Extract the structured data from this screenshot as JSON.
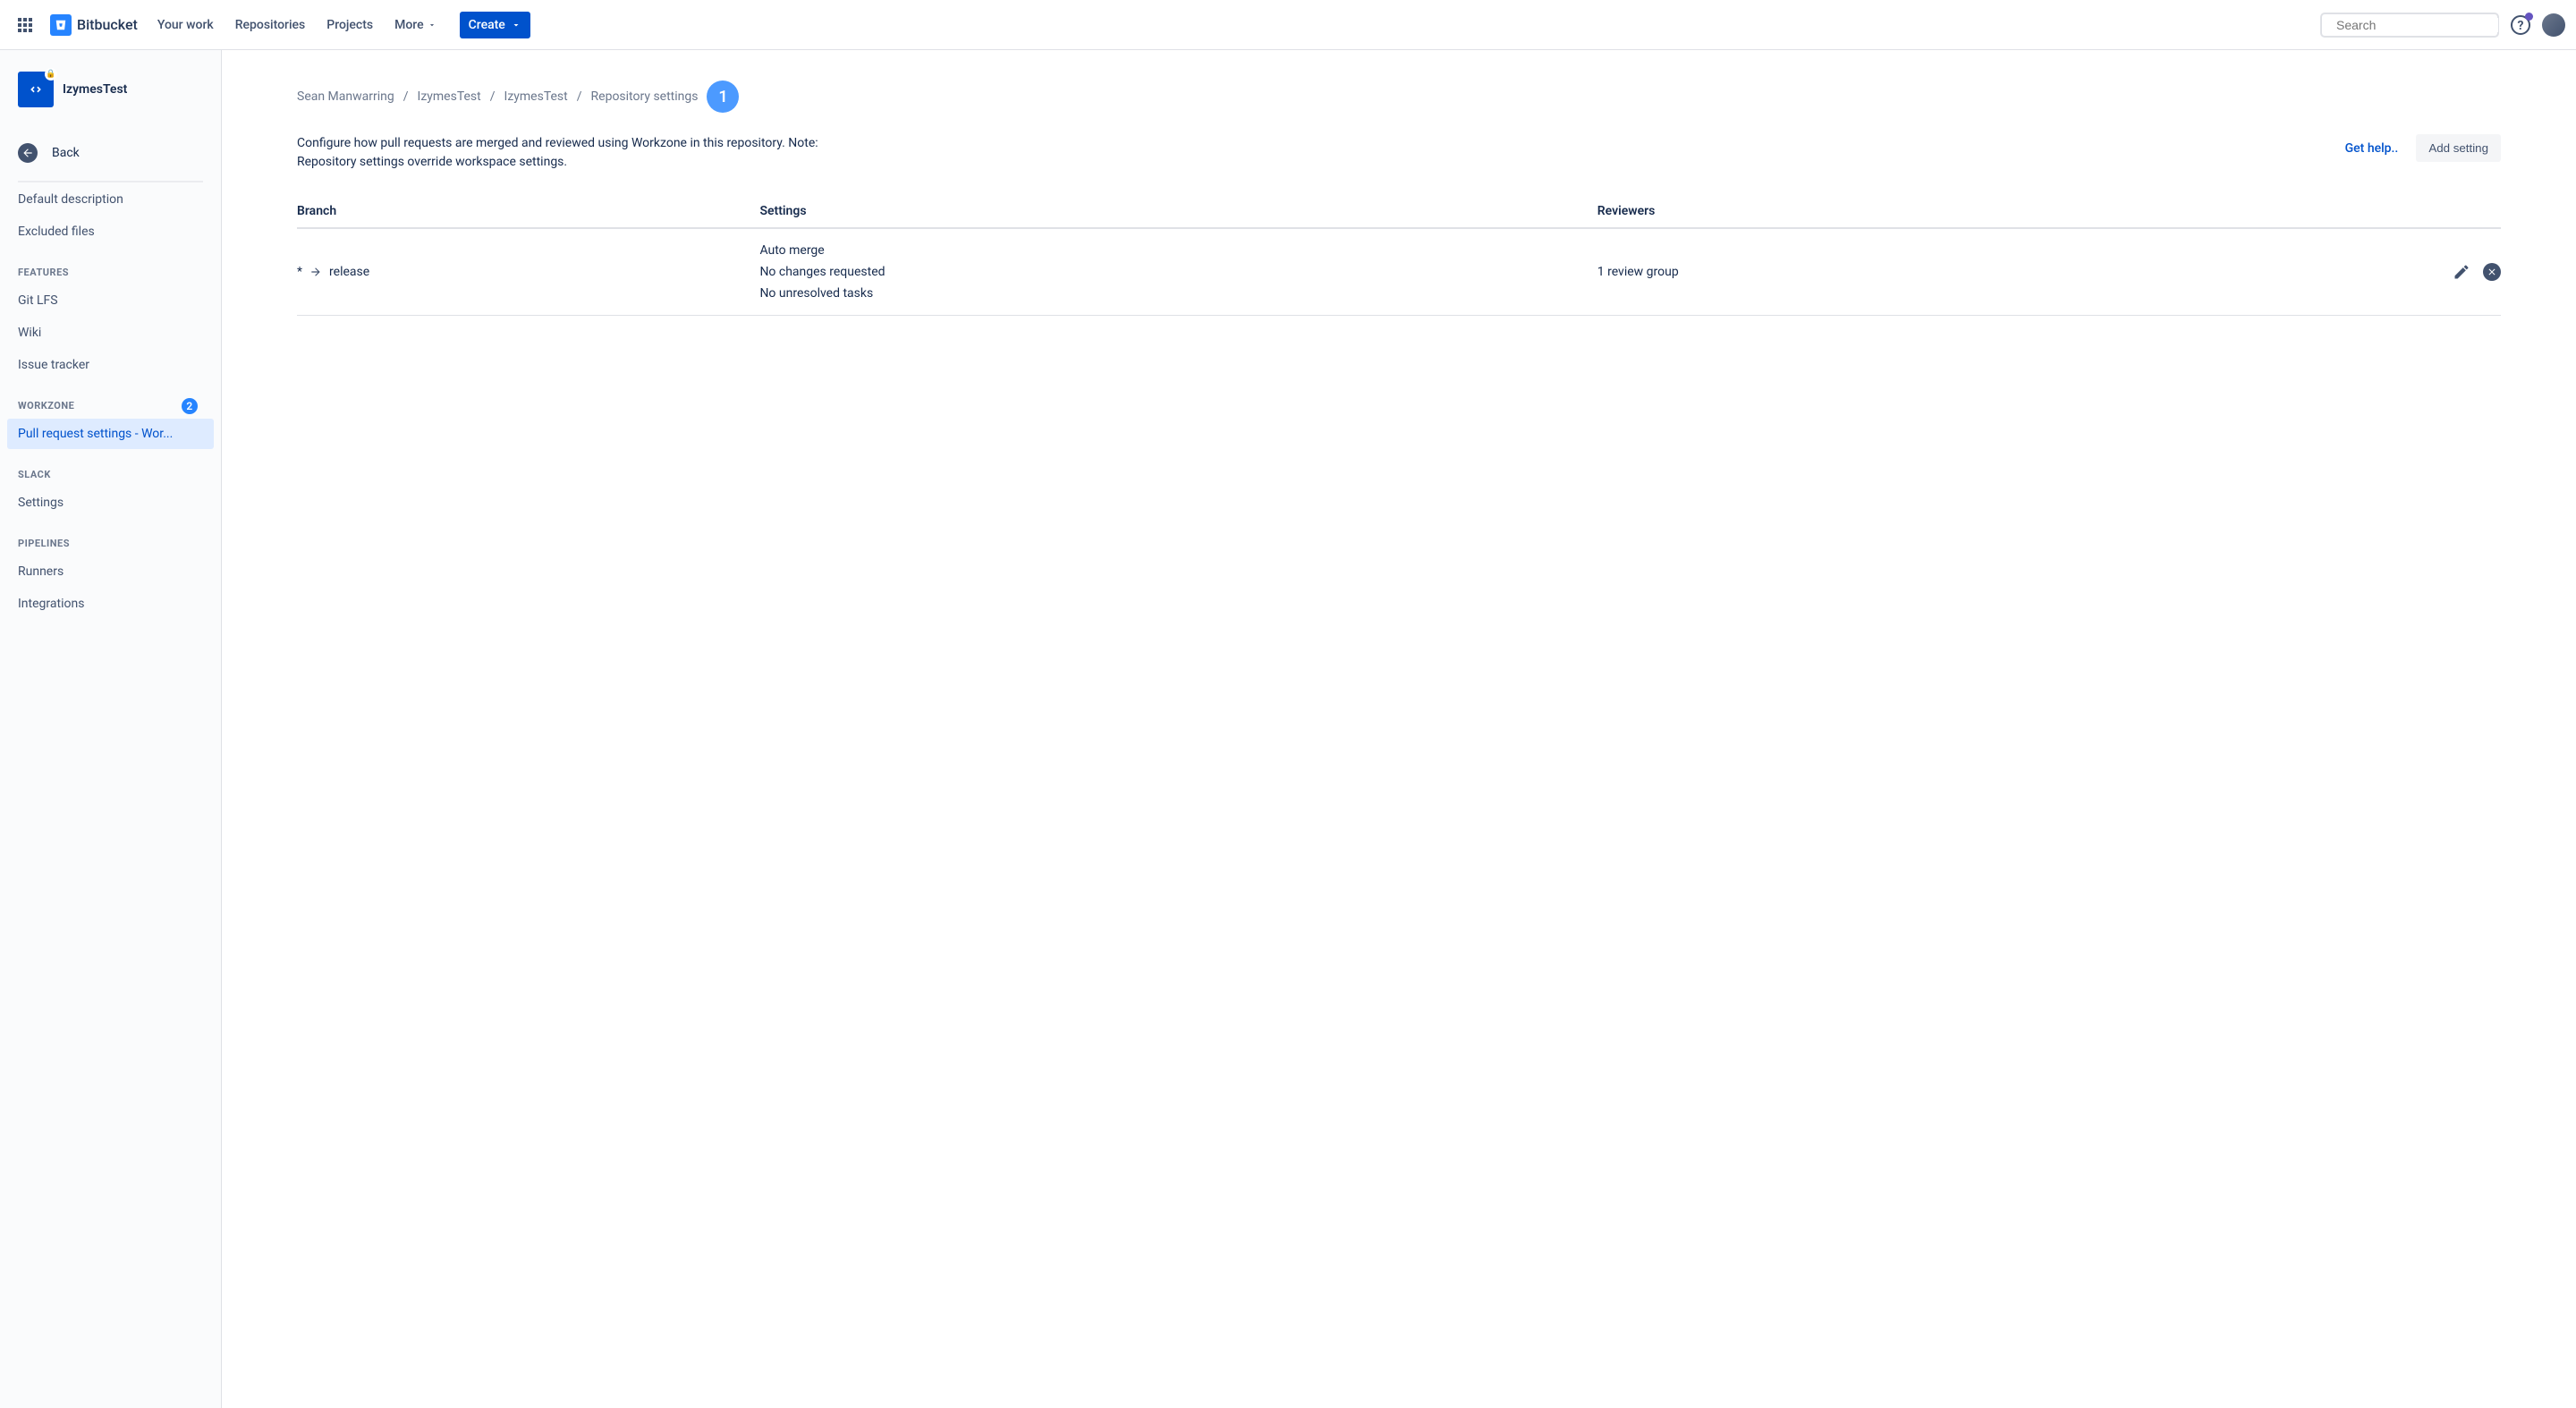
{
  "topnav": {
    "product": "Bitbucket",
    "links": {
      "your_work": "Your work",
      "repositories": "Repositories",
      "projects": "Projects",
      "more": "More"
    },
    "create": "Create",
    "search_placeholder": "Search"
  },
  "sidebar": {
    "repo_name": "IzymesTest",
    "back": "Back",
    "items_top": [
      "Default description",
      "Excluded files"
    ],
    "sections": {
      "features": {
        "title": "FEATURES",
        "items": [
          "Git LFS",
          "Wiki",
          "Issue tracker"
        ]
      },
      "workzone": {
        "title": "WORKZONE",
        "badge": "2",
        "items": [
          "Pull request settings - Wor..."
        ]
      },
      "slack": {
        "title": "SLACK",
        "items": [
          "Settings"
        ]
      },
      "pipelines": {
        "title": "PIPELINES",
        "items": [
          "Runners",
          "Integrations"
        ]
      }
    }
  },
  "main": {
    "breadcrumb": [
      "Sean Manwarring",
      "IzymesTest",
      "IzymesTest",
      "Repository settings"
    ],
    "badge_num": "1",
    "description": "Configure how pull requests are merged and reviewed using Workzone in this repository. Note: Repository settings override workspace settings.",
    "help_link": "Get help..",
    "add_button": "Add setting",
    "table": {
      "headers": {
        "branch": "Branch",
        "settings": "Settings",
        "reviewers": "Reviewers"
      },
      "rows": [
        {
          "source": "*",
          "target": "release",
          "settings": [
            "Auto merge",
            "No changes requested",
            "No unresolved tasks"
          ],
          "reviewers": "1 review group"
        }
      ]
    }
  }
}
